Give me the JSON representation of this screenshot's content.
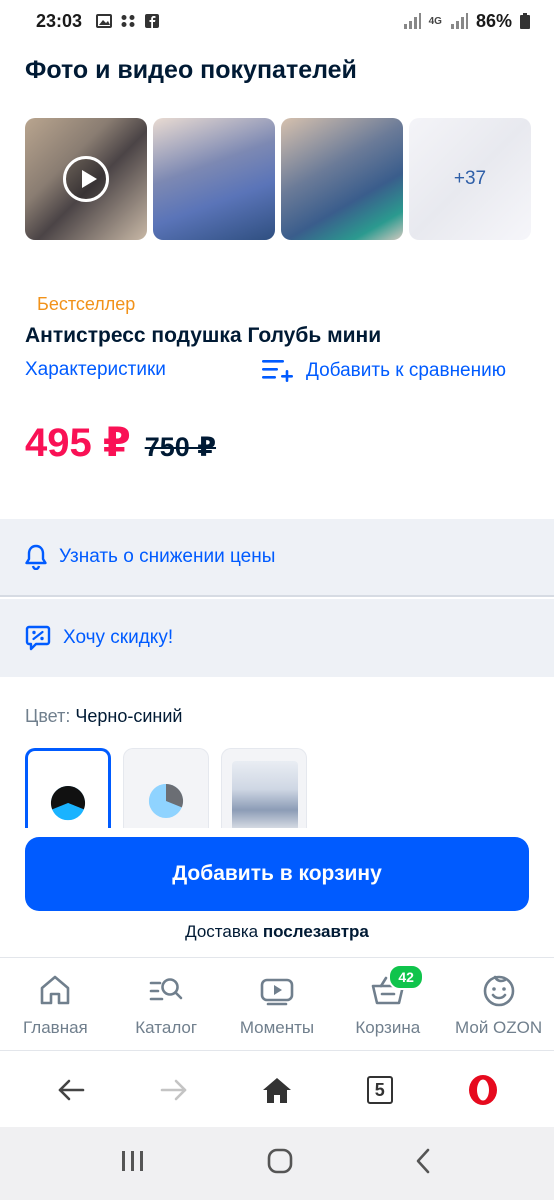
{
  "status_bar": {
    "time": "23:03",
    "network": "4G",
    "battery": "86%"
  },
  "gallery": {
    "title": "Фото и видео покупателей",
    "more_count": "+37"
  },
  "product": {
    "badge": "Бестселлер",
    "title": "Антистресс подушка Голубь мини",
    "specs_link": "Характеристики",
    "compare_link": "Добавить к сравнению",
    "price": "495 ₽",
    "old_price": "750 ₽"
  },
  "actions": {
    "price_alert": "Узнать о снижении цены",
    "want_discount": "Хочу скидку!"
  },
  "color": {
    "label": "Цвет:",
    "value": "Черно-синий"
  },
  "cart": {
    "button_label": "Добавить в корзину",
    "delivery_prefix": "Доставка",
    "delivery_when": "послезавтра"
  },
  "bottom_nav": {
    "items": [
      {
        "label": "Главная",
        "icon": "home-icon"
      },
      {
        "label": "Каталог",
        "icon": "catalog-search-icon"
      },
      {
        "label": "Моменты",
        "icon": "moments-play-icon"
      },
      {
        "label": "Корзина",
        "icon": "cart-icon",
        "badge": "42"
      },
      {
        "label": "Мой OZON",
        "icon": "profile-smile-icon"
      }
    ]
  },
  "browser": {
    "tab_count": "5"
  },
  "colors": {
    "accent": "#005bff",
    "price": "#f91155",
    "badge": "#f1921a",
    "cart_badge": "#10c44c"
  }
}
